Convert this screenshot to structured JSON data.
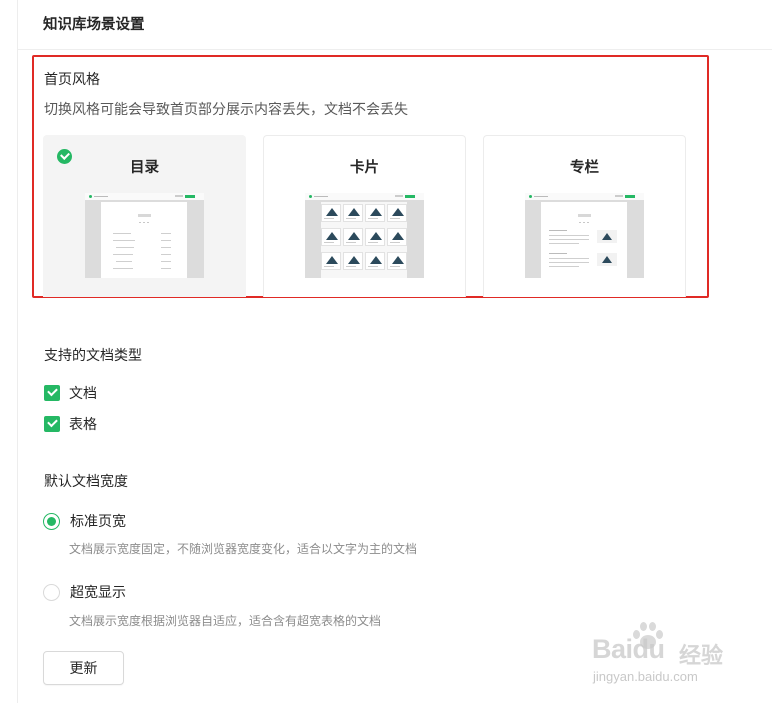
{
  "header": {
    "title": "知识库场景设置"
  },
  "homepage_style": {
    "title": "首页风格",
    "description": "切换风格可能会导致首页部分展示内容丢失，文档不会丢失",
    "options": [
      {
        "label": "目录",
        "selected": true
      },
      {
        "label": "卡片",
        "selected": false
      },
      {
        "label": "专栏",
        "selected": false
      }
    ]
  },
  "doc_types": {
    "title": "支持的文档类型",
    "items": [
      {
        "label": "文档",
        "checked": true
      },
      {
        "label": "表格",
        "checked": true
      }
    ]
  },
  "doc_width": {
    "title": "默认文档宽度",
    "options": [
      {
        "label": "标准页宽",
        "description": "文档展示宽度固定，不随浏览器宽度变化，适合以文字为主的文档",
        "checked": true
      },
      {
        "label": "超宽显示",
        "description": "文档展示宽度根据浏览器自适应，适合含有超宽表格的文档",
        "checked": false
      }
    ]
  },
  "actions": {
    "update_label": "更新"
  },
  "watermark": {
    "logo": "Baidu",
    "jingyan": "经验",
    "url": "jingyan.baidu.com"
  },
  "colors": {
    "accent": "#25b864",
    "highlight": "#e02a25",
    "thumb_image": "#2c4a5c"
  },
  "icons": {
    "selected_badge": "check-circle-icon",
    "checkbox": "checkbox-checked-icon"
  }
}
